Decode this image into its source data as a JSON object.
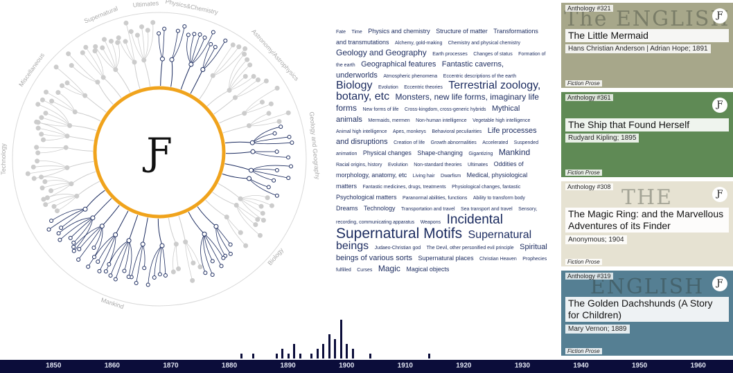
{
  "center_logo": "Ƒ",
  "ring_labels": [
    "Supernatural",
    "Ultimates",
    "Physics&Chemistry",
    "Astronomy/Astrophysics",
    "Geology and Geography",
    "Biology",
    "Mankind",
    "Technology",
    "Miscellaneous"
  ],
  "tag_cloud": [
    {
      "text": "Fate",
      "t": 1
    },
    {
      "text": "Time",
      "t": 1
    },
    {
      "text": "Physics and chemistry",
      "t": 2
    },
    {
      "text": "Structure of matter",
      "t": 2
    },
    {
      "text": "Transformations and transmutations",
      "t": 2
    },
    {
      "text": "Alchemy, gold-making",
      "t": 1
    },
    {
      "text": "Chemistry and physical chemistry",
      "t": 1
    },
    {
      "text": "Geology and Geography",
      "t": 4
    },
    {
      "text": "Earth processes",
      "t": 1
    },
    {
      "text": "Changes of status",
      "t": 1
    },
    {
      "text": "Formation of the earth",
      "t": 1
    },
    {
      "text": "Geographical features",
      "t": 3
    },
    {
      "text": "Fantastic caverns, underworlds",
      "t": 3
    },
    {
      "text": "Atmospheric phenomena",
      "t": 1
    },
    {
      "text": "Eccentric descriptions of the earth",
      "t": 1
    },
    {
      "text": "Biology",
      "t": 5
    },
    {
      "text": "Evolution",
      "t": 1
    },
    {
      "text": "Eccentric theories",
      "t": 1
    },
    {
      "text": "Terrestrial zoology, botany, etc",
      "t": 5
    },
    {
      "text": "Monsters, new life forms, imaginary life forms",
      "t": 4
    },
    {
      "text": "New forms of life",
      "t": 1
    },
    {
      "text": "Cross-kingdom, cross-generic hybrids",
      "t": 1
    },
    {
      "text": "Mythical animals",
      "t": 3
    },
    {
      "text": "Mermaids, mermen",
      "t": 1
    },
    {
      "text": "Non-human intelligence",
      "t": 1
    },
    {
      "text": "Vegetable high intelligence",
      "t": 1
    },
    {
      "text": "Animal high intelligence",
      "t": 1
    },
    {
      "text": "Apes, monkeys",
      "t": 1
    },
    {
      "text": "Behavioral peculiarities",
      "t": 1
    },
    {
      "text": "Life processes and disruptions",
      "t": 3
    },
    {
      "text": "Creation of life",
      "t": 1
    },
    {
      "text": "Growth abnormalities",
      "t": 1
    },
    {
      "text": "Accelerated",
      "t": 1
    },
    {
      "text": "Suspended animation",
      "t": 1
    },
    {
      "text": "Physical changes",
      "t": 2
    },
    {
      "text": "Shape-changing",
      "t": 2
    },
    {
      "text": "Gigantizing",
      "t": 1
    },
    {
      "text": "Mankind",
      "t": 4
    },
    {
      "text": "Racial origins, history",
      "t": 1
    },
    {
      "text": "Evolution",
      "t": 1
    },
    {
      "text": "Non-standard theories",
      "t": 1
    },
    {
      "text": "Ultimates",
      "t": 1
    },
    {
      "text": "Oddities of morphology, anatomy, etc",
      "t": 2
    },
    {
      "text": "Living hair",
      "t": 1
    },
    {
      "text": "Dwarfism",
      "t": 1
    },
    {
      "text": "Medical, physiological matters",
      "t": 2
    },
    {
      "text": "Fantastic medicines, drugs, treatments",
      "t": 1
    },
    {
      "text": "Physiological changes, fantastic",
      "t": 1
    },
    {
      "text": "Psychological matters",
      "t": 2
    },
    {
      "text": "Paranormal abilities, functions",
      "t": 1
    },
    {
      "text": "Ability to transform body",
      "t": 1
    },
    {
      "text": "Dreams",
      "t": 2
    },
    {
      "text": "Technology",
      "t": 2
    },
    {
      "text": "Transportation and travel",
      "t": 1
    },
    {
      "text": "Sea transport and travel",
      "t": 1
    },
    {
      "text": "Sensory, recording, communicating apparatus",
      "t": 1
    },
    {
      "text": "Weapons",
      "t": 1
    },
    {
      "text": "Incidental",
      "t": 6
    },
    {
      "text": "Supernatural Motifs",
      "t": 7
    },
    {
      "text": "Supernatural beings",
      "t": 5
    },
    {
      "text": "Judaeo-Christian god",
      "t": 1
    },
    {
      "text": "The Devil, other personified evil principle",
      "t": 1
    },
    {
      "text": "Spiritual beings of various sorts",
      "t": 3
    },
    {
      "text": "Supernatural places",
      "t": 2
    },
    {
      "text": "Christian Heaven",
      "t": 1
    },
    {
      "text": "Prophecies fulfilled",
      "t": 1
    },
    {
      "text": "Curses",
      "t": 1
    },
    {
      "text": "Magic",
      "t": 4
    },
    {
      "text": "Magical objects",
      "t": 2
    }
  ],
  "cards": [
    {
      "anthology": "Anthology #321",
      "title": "The Little Mermaid",
      "author": "Hans Christian Anderson | Adrian Hope; 1891",
      "genre": "Fiction Prose",
      "bg_text": "The ENGLISH",
      "bg": "#a7a78a",
      "title_h": 1
    },
    {
      "anthology": "Anthology #361",
      "title": "The Ship that Found Herself",
      "author": "Rudyard Kipling; 1895",
      "genre": "Fiction Prose",
      "bg_text": "",
      "bg": "#5f8a55",
      "title_h": 1
    },
    {
      "anthology": "Anthology #308",
      "title": "The Magic Ring: and the Marvellous Adventures of its Finder",
      "author": "Anonymous; 1904",
      "genre": "Fiction Prose",
      "bg_text": "THE",
      "bg": "#e6e2d2",
      "title_h": 2
    },
    {
      "anthology": "Anthology #319",
      "title": "The Golden Dachshunds (A Story for Children)",
      "author": "Mary Vernon; 1889",
      "genre": "Fiction Prose",
      "bg_text": "ENGLISH",
      "bg": "#557f93",
      "title_h": 2
    }
  ],
  "timeline": {
    "ticks": [
      "1850",
      "1860",
      "1870",
      "1880",
      "1890",
      "1900",
      "1910",
      "1920",
      "1930",
      "1940",
      "1950",
      "1960"
    ],
    "year_start": 1845,
    "year_end": 1965,
    "histogram": [
      {
        "year": 1882,
        "count": 1
      },
      {
        "year": 1884,
        "count": 1
      },
      {
        "year": 1888,
        "count": 1
      },
      {
        "year": 1889,
        "count": 2
      },
      {
        "year": 1890,
        "count": 1
      },
      {
        "year": 1891,
        "count": 3
      },
      {
        "year": 1892,
        "count": 1
      },
      {
        "year": 1894,
        "count": 1
      },
      {
        "year": 1895,
        "count": 2
      },
      {
        "year": 1896,
        "count": 3
      },
      {
        "year": 1897,
        "count": 5
      },
      {
        "year": 1898,
        "count": 4
      },
      {
        "year": 1899,
        "count": 8
      },
      {
        "year": 1900,
        "count": 3
      },
      {
        "year": 1901,
        "count": 2
      },
      {
        "year": 1904,
        "count": 1
      },
      {
        "year": 1914,
        "count": 1
      }
    ]
  },
  "colors": {
    "accent_ring": "#f0a31c",
    "navy": "#0b0d3a",
    "link_dark": "#1a2a5e",
    "link_light": "#cccccc"
  }
}
